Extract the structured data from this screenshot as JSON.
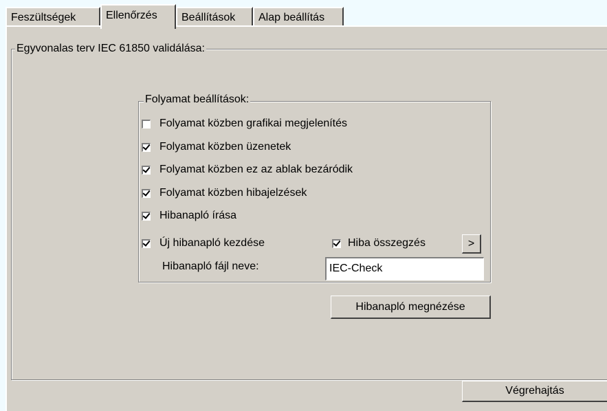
{
  "tabs": [
    {
      "label": "Feszültségek",
      "active": false
    },
    {
      "label": "Ellenőrzés",
      "active": true
    },
    {
      "label": "Beállítások",
      "active": false
    },
    {
      "label": "Alap beállítás",
      "active": false
    }
  ],
  "main_group": {
    "title": "Egyvonalas terv IEC 61850 validálása:"
  },
  "process_group": {
    "title": "Folyamat beállítások:",
    "checkboxes": [
      {
        "label": "Folyamat közben grafikai megjelenítés",
        "checked": false
      },
      {
        "label": "Folyamat közben üzenetek",
        "checked": true
      },
      {
        "label": "Folyamat közben ez az ablak bezáródik",
        "checked": true
      },
      {
        "label": "Folyamat közben hibajelzések",
        "checked": true
      },
      {
        "label": "Hibanapló írása",
        "checked": true
      },
      {
        "label": "Új hibanapló kezdése",
        "checked": true
      }
    ],
    "error_summary": {
      "label": "Hiba összegzés",
      "checked": true
    },
    "arrow_button": ">",
    "log_file_label": "Hibanapló fájl neve:",
    "log_file_value": "IEC-Check"
  },
  "view_log_button": "Hibanapló megnézése",
  "execute_button": "Végrehajtás"
}
